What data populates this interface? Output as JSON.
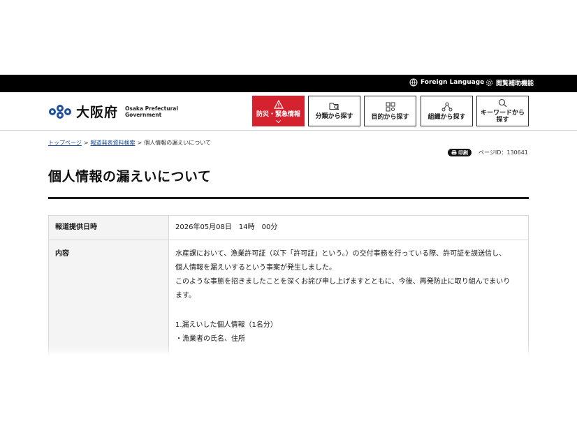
{
  "topbar": {
    "foreign_language": "Foreign Language",
    "accessibility": "閲覧補助機能"
  },
  "header": {
    "logo_jp": "大阪府",
    "logo_en_line1": "Osaka Prefectural",
    "logo_en_line2": "Government",
    "nav": [
      {
        "label": "防災・緊急情報",
        "icon": "warning-icon"
      },
      {
        "label": "分類から探す",
        "icon": "folder-search-icon"
      },
      {
        "label": "目的から探す",
        "icon": "grid-icon"
      },
      {
        "label": "組織から探す",
        "icon": "org-icon"
      },
      {
        "label": "キーワードから探す",
        "icon": "search-icon"
      }
    ],
    "accent_color": "#d4232f"
  },
  "breadcrumb": {
    "items": [
      "トップページ",
      "報道発表資料検索"
    ],
    "current": "個人情報の漏えいについて",
    "separator": ">"
  },
  "print_label": "印刷",
  "page_id": "ページID：130641",
  "page_title": "個人情報の漏えいについて",
  "table": {
    "date_label": "報道提供日時",
    "date_value": "2026年05月08日　14時　00分",
    "content_label": "内容",
    "para1_line1": "水産課において、漁業許可証（以下「許可証」という。）の交付事務を行っている際、許可証を誤送信し、",
    "para1_line2": "個人情報を漏えいするという事案が発生しました。",
    "para2_line1": "このような事態を招きましたことを深くお詫び申し上げますとともに、今後、再発防止に取り組んでまいり",
    "para2_line2": "ます。",
    "section1_title": "1.漏えいした個人情報（1名分）",
    "section1_item": "・漁業者の氏名、住所"
  }
}
